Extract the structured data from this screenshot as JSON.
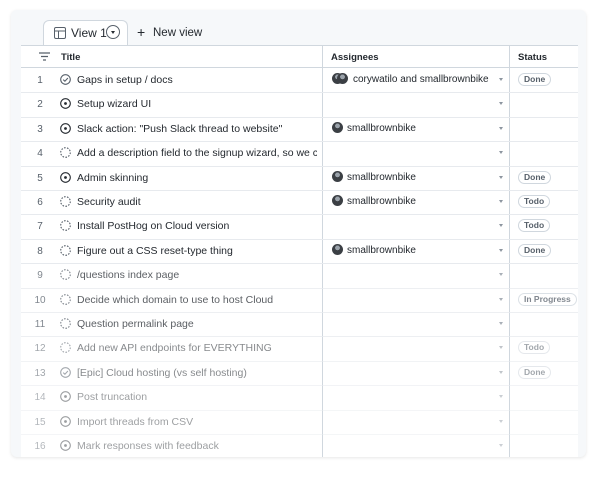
{
  "tabs": {
    "active_label": "View 1",
    "new_view_label": "New view"
  },
  "columns": {
    "title": "Title",
    "assignees": "Assignees",
    "status": "Status"
  },
  "rows": [
    {
      "num": "1",
      "state": "done",
      "title": "Gaps in setup / docs",
      "assignees": "corywatilo and smallbrownbike",
      "avatars": 2,
      "status": "Done"
    },
    {
      "num": "2",
      "state": "open",
      "title": "Setup wizard UI",
      "assignees": "",
      "avatars": 0,
      "status": ""
    },
    {
      "num": "3",
      "state": "open",
      "title": "Slack action: \"Push Slack thread to website\"",
      "assignees": "smallbrownbike",
      "avatars": 1,
      "status": ""
    },
    {
      "num": "4",
      "state": "draft",
      "title": "Add a description field to the signup wizard, so we can e",
      "assignees": "",
      "avatars": 0,
      "status": ""
    },
    {
      "num": "5",
      "state": "open",
      "title": "Admin skinning",
      "assignees": "smallbrownbike",
      "avatars": 1,
      "status": "Done"
    },
    {
      "num": "6",
      "state": "draft",
      "title": "Security audit",
      "assignees": "smallbrownbike",
      "avatars": 1,
      "status": "Todo"
    },
    {
      "num": "7",
      "state": "draft",
      "title": "Install PostHog on Cloud version",
      "assignees": "",
      "avatars": 0,
      "status": "Todo"
    },
    {
      "num": "8",
      "state": "draft",
      "title": "Figure out a CSS reset-type thing",
      "assignees": "smallbrownbike",
      "avatars": 1,
      "status": "Done"
    },
    {
      "num": "9",
      "state": "draft",
      "title": "/questions index page",
      "assignees": "",
      "avatars": 0,
      "status": ""
    },
    {
      "num": "10",
      "state": "draft",
      "title": "Decide which domain to use to host Cloud",
      "assignees": "",
      "avatars": 0,
      "status": "In Progress"
    },
    {
      "num": "11",
      "state": "draft",
      "title": "Question permalink page",
      "assignees": "",
      "avatars": 0,
      "status": ""
    },
    {
      "num": "12",
      "state": "draft",
      "title": "Add new API endpoints for EVERYTHING",
      "assignees": "",
      "avatars": 0,
      "status": "Todo"
    },
    {
      "num": "13",
      "state": "done",
      "title": "[Epic] Cloud hosting (vs self hosting)",
      "assignees": "",
      "avatars": 0,
      "status": "Done"
    },
    {
      "num": "14",
      "state": "open",
      "title": "Post truncation",
      "assignees": "",
      "avatars": 0,
      "status": ""
    },
    {
      "num": "15",
      "state": "open",
      "title": "Import threads from CSV",
      "assignees": "",
      "avatars": 0,
      "status": ""
    },
    {
      "num": "16",
      "state": "open",
      "title": "Mark responses with feedback",
      "assignees": "",
      "avatars": 0,
      "status": ""
    }
  ],
  "colors": {
    "border": "#d0d7de",
    "text": "#24292f",
    "muted": "#57606a"
  }
}
